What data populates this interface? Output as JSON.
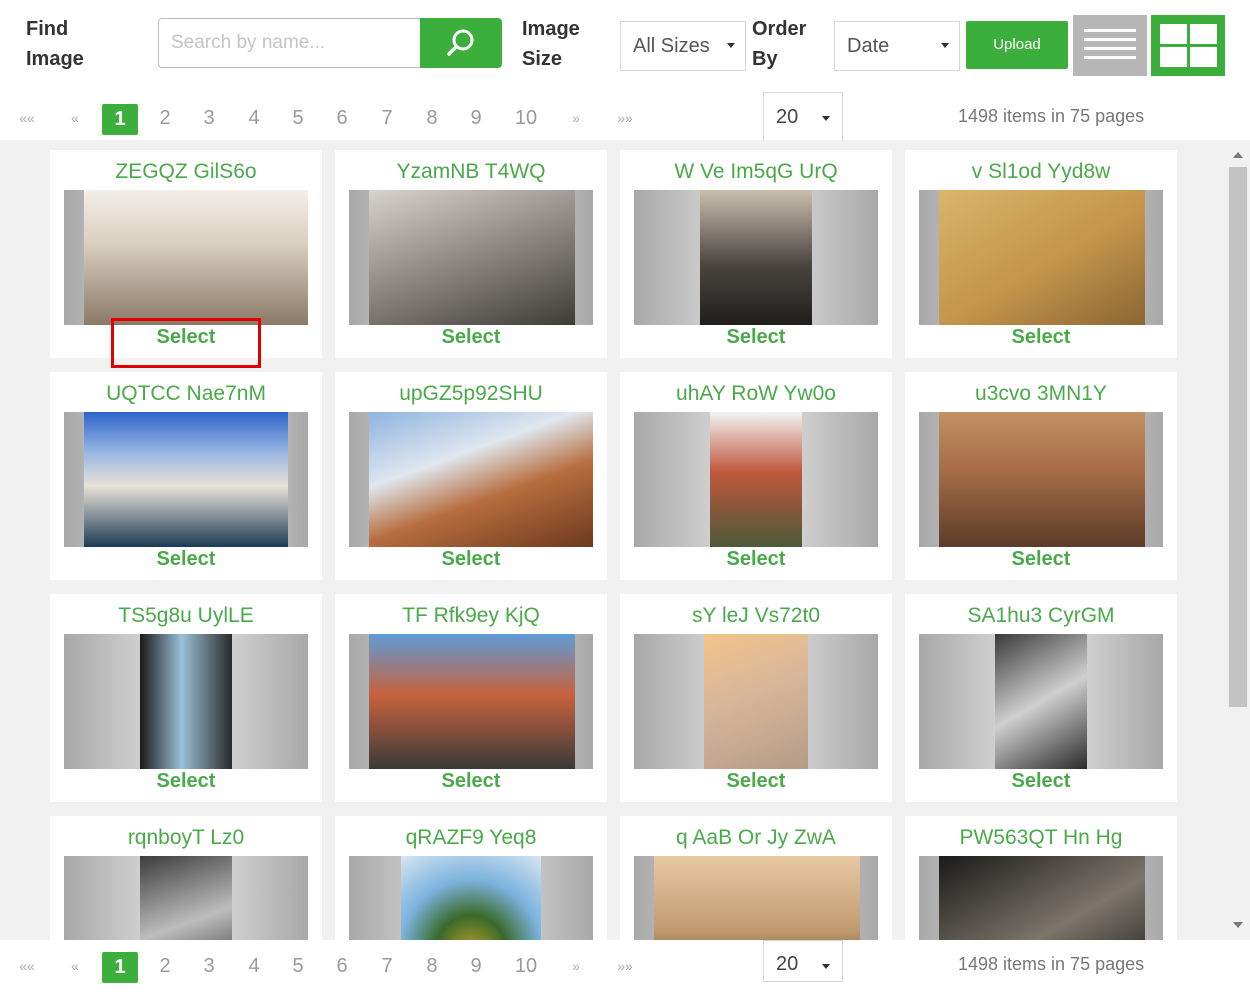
{
  "toolbar": {
    "find_image_label": [
      "Find",
      "Image"
    ],
    "search_placeholder": "Search by name...",
    "image_size_label": [
      "Image",
      "Size"
    ],
    "image_size_value": "All Sizes",
    "order_by_label": [
      "Order",
      "By"
    ],
    "order_by_value": "Date",
    "upload_label": "Upload",
    "search_icon": "search-icon",
    "list_view_icon": "list-view-icon",
    "grid_view_icon": "grid-view-icon"
  },
  "pagination": {
    "first": "««",
    "prev": "«",
    "pages": [
      "1",
      "2",
      "3",
      "4",
      "5",
      "6",
      "7",
      "8",
      "9",
      "10"
    ],
    "current_page": "1",
    "next": "»",
    "last": "»»",
    "per_page": "20",
    "info": "1498 items in 75 pages"
  },
  "colors": {
    "accent": "#3cae3c",
    "title_green": "#4aa94a",
    "highlight": "#e00000"
  },
  "select_label": "Select",
  "images": [
    {
      "name": "ZEGQZ GilS6o",
      "photo": "statues"
    },
    {
      "name": "YzamNB T4WQ",
      "photo": "sculpture"
    },
    {
      "name": "W Ve Im5qG UrQ",
      "photo": "violinist"
    },
    {
      "name": "v Sl1od Yyd8w",
      "photo": "bicycle"
    },
    {
      "name": "UQTCC Nae7nM",
      "photo": "fountain"
    },
    {
      "name": "upGZ5p92SHU",
      "photo": "colosseum"
    },
    {
      "name": "uhAY RoW Yw0o",
      "photo": "street"
    },
    {
      "name": "u3cvo 3MN1Y",
      "photo": "crowd"
    },
    {
      "name": "TS5g8u UylLE",
      "photo": "window"
    },
    {
      "name": "TF Rfk9ey KjQ",
      "photo": "piazza"
    },
    {
      "name": "sY leJ Vs72t0",
      "photo": "dome"
    },
    {
      "name": "SA1hu3 CyrGM",
      "photo": "marble"
    },
    {
      "name": "rqnboyT Lz0",
      "photo": "angel"
    },
    {
      "name": "qRAZF9 Yeq8",
      "photo": "planet"
    },
    {
      "name": "q AaB Or Jy ZwA",
      "photo": "doorway"
    },
    {
      "name": "PW563QT Hn Hg",
      "photo": "david"
    }
  ]
}
